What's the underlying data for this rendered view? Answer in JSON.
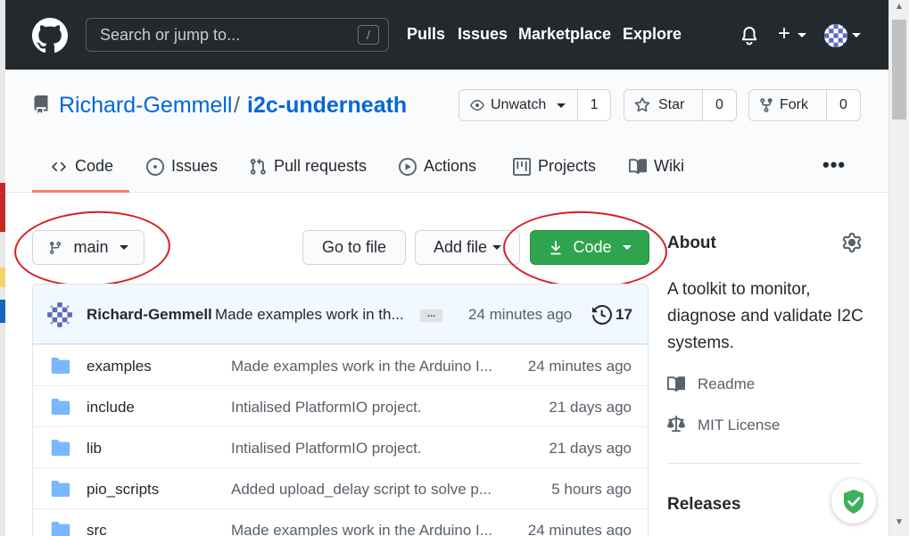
{
  "header": {
    "search_placeholder": "Search or jump to...",
    "search_shortcut": "/",
    "nav": [
      "Pulls",
      "Issues",
      "Marketplace",
      "Explore"
    ],
    "plus_label": "+"
  },
  "repo": {
    "owner": "Richard-Gemmell",
    "separator": "/",
    "name": "i2c-underneath",
    "watch_label": "Unwatch",
    "watch_count": "1",
    "star_label": "Star",
    "star_count": "0",
    "fork_label": "Fork",
    "fork_count": "0"
  },
  "tabs": [
    "Code",
    "Issues",
    "Pull requests",
    "Actions",
    "Projects",
    "Wiki"
  ],
  "tabs_more": "•••",
  "toolbar": {
    "branch": "main",
    "go_to_file": "Go to file",
    "add_file": "Add file",
    "code": "Code"
  },
  "commit": {
    "author": "Richard-Gemmell",
    "message": "Made examples work in th...",
    "ellipsis": "...",
    "time": "24 minutes ago",
    "count": "17"
  },
  "files": [
    {
      "name": "examples",
      "message": "Made examples work in the Arduino I...",
      "time": "24 minutes ago"
    },
    {
      "name": "include",
      "message": "Intialised PlatformIO project.",
      "time": "21 days ago"
    },
    {
      "name": "lib",
      "message": "Intialised PlatformIO project.",
      "time": "21 days ago"
    },
    {
      "name": "pio_scripts",
      "message": "Added upload_delay script to solve p...",
      "time": "5 hours ago"
    },
    {
      "name": "src",
      "message": "Made examples work in the Arduino I...",
      "time": "24 minutes ago"
    }
  ],
  "about": {
    "title": "About",
    "description": "A toolkit to monitor, diagnose and validate I2C systems.",
    "readme": "Readme",
    "license": "MIT License",
    "releases_title": "Releases"
  },
  "colors": {
    "header_bg": "#24292e",
    "link": "#0366d6",
    "code_button": "#2ea44f",
    "annotation_red": "#d81e24",
    "tab_underline": "#f9826c"
  }
}
